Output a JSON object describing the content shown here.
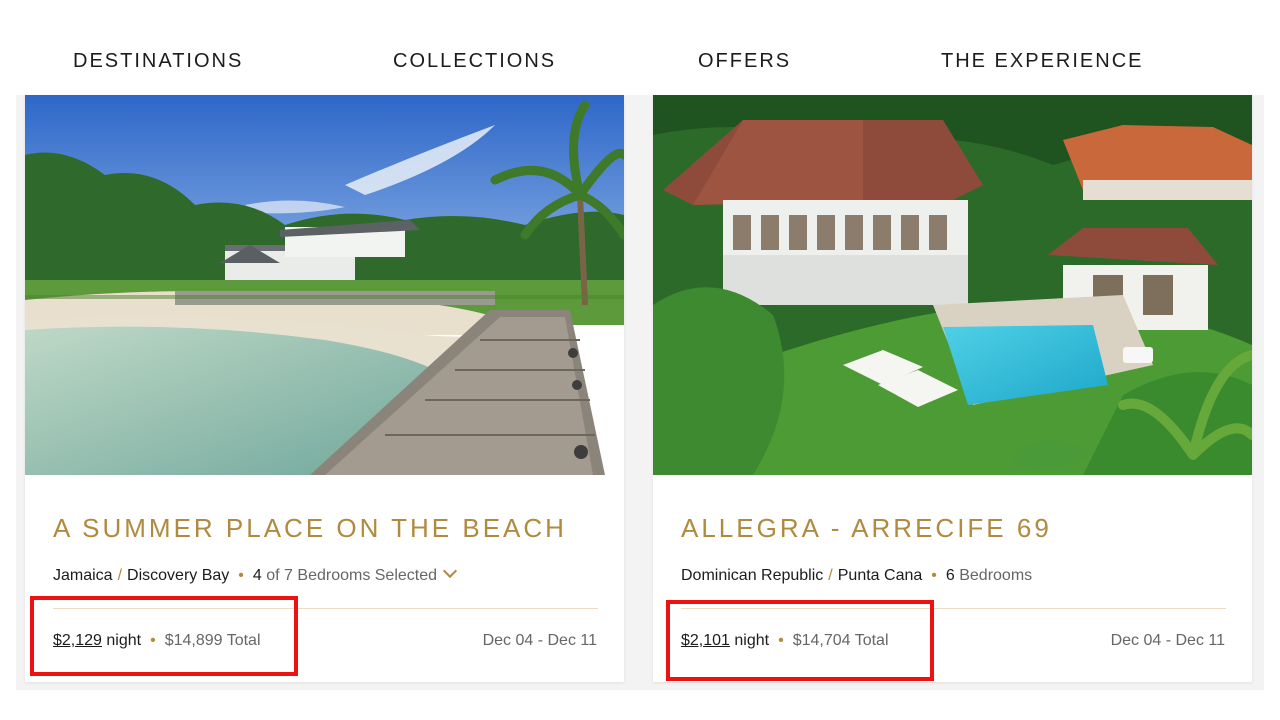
{
  "nav": {
    "items": [
      "DESTINATIONS",
      "COLLECTIONS",
      "OFFERS",
      "THE EXPERIENCE"
    ]
  },
  "cards": [
    {
      "title": "A SUMMER PLACE ON THE BEACH",
      "country": "Jamaica",
      "region": "Discovery Bay",
      "bedrooms_num": "4",
      "bedrooms_of": "of 7",
      "bedrooms_label": "Bedrooms Selected",
      "price": "$2,129",
      "per": "night",
      "total": "$14,899 Total",
      "dates": "Dec 04 - Dec 11"
    },
    {
      "title": "ALLEGRA - ARRECIFE 69",
      "country": "Dominican Republic",
      "region": "Punta Cana",
      "bedrooms_num": "6",
      "bedrooms_label": "Bedrooms",
      "price": "$2,101",
      "per": "night",
      "total": "$14,704 Total",
      "dates": "Dec 04 - Dec 11"
    }
  ],
  "colors": {
    "accent_gold": "#b08a3e",
    "highlight_red": "#ee1111"
  },
  "icons": {
    "bedroom_toggle": "chevron-down-icon"
  }
}
